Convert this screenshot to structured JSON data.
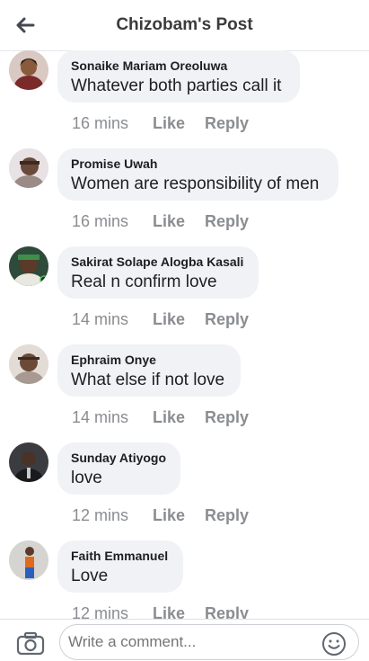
{
  "header": {
    "title": "Chizobam's Post",
    "back_icon": "back-arrow-icon"
  },
  "comments": [
    {
      "author": "Sonaike Mariam Oreoluwa",
      "text": "Whatever both parties call it",
      "time": "16 mins",
      "like": "Like",
      "reply": "Reply"
    },
    {
      "author": "Promise Uwah",
      "text": "Women are responsibility of men",
      "time": "16 mins",
      "like": "Like",
      "reply": "Reply"
    },
    {
      "author": "Sakirat Solape Alogba Kasali",
      "text": "Real n confirm love",
      "time": "14 mins",
      "like": "Like",
      "reply": "Reply"
    },
    {
      "author": "Ephraim Onye",
      "text": "What else if not love",
      "time": "14 mins",
      "like": "Like",
      "reply": "Reply"
    },
    {
      "author": "Sunday Atiyogo",
      "text": "love",
      "time": "12 mins",
      "like": "Like",
      "reply": "Reply"
    },
    {
      "author": "Faith Emmanuel",
      "text": "Love",
      "time": "12 mins",
      "like": "Like",
      "reply": "Reply"
    }
  ],
  "composer": {
    "placeholder": "Write a comment...",
    "camera_icon": "camera-icon",
    "emoji_icon": "emoji-icon"
  },
  "colors": {
    "bubble": "#f0f2f5",
    "meta": "#8a8d91",
    "title": "#3a3b3c"
  }
}
